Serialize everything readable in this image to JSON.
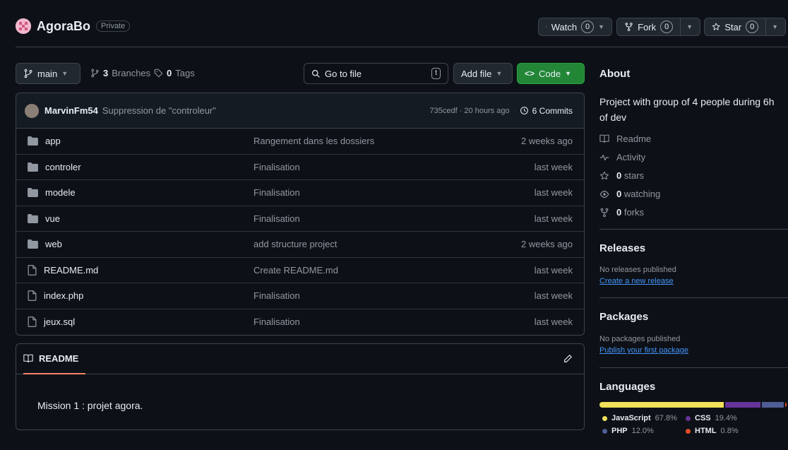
{
  "repo": {
    "name": "AgoraBo",
    "visibility": "Private"
  },
  "actions": {
    "watch_label": "Watch",
    "watch_count": "0",
    "fork_label": "Fork",
    "fork_count": "0",
    "star_label": "Star",
    "star_count": "0"
  },
  "toolbar": {
    "branch": "main",
    "branches_count": "3",
    "branches_label": "Branches",
    "tags_count": "0",
    "tags_label": "Tags",
    "go_to_file_placeholder": "Go to file",
    "go_to_file_key": "t",
    "add_file_label": "Add file",
    "code_label": "Code"
  },
  "commit": {
    "author": "MarvinFm54",
    "message": "Suppression de \"controleur\"",
    "meta": "735cedf · 20 hours ago",
    "commits_label": "6 Commits"
  },
  "files": [
    {
      "type": "folder",
      "name": "app",
      "message": "Rangement dans les dossiers",
      "date": "2 weeks ago"
    },
    {
      "type": "folder",
      "name": "controler",
      "message": "Finalisation",
      "date": "last week"
    },
    {
      "type": "folder",
      "name": "modele",
      "message": "Finalisation",
      "date": "last week"
    },
    {
      "type": "folder",
      "name": "vue",
      "message": "Finalisation",
      "date": "last week"
    },
    {
      "type": "folder",
      "name": "web",
      "message": "add structure project",
      "date": "2 weeks ago"
    },
    {
      "type": "file",
      "name": "README.md",
      "message": "Create README.md",
      "date": "last week"
    },
    {
      "type": "file",
      "name": "index.php",
      "message": "Finalisation",
      "date": "last week"
    },
    {
      "type": "file",
      "name": "jeux.sql",
      "message": "Finalisation",
      "date": "last week"
    }
  ],
  "readme": {
    "tab_label": "README",
    "content": "Mission 1 : projet agora."
  },
  "about": {
    "title": "About",
    "description_line1": "Project with group of 4 people during 6h",
    "description_line2": "of dev",
    "readme_label": "Readme",
    "activity_label": "Activity",
    "stars_count": "0",
    "stars_label": "stars",
    "watching_count": "0",
    "watching_label": "watching",
    "forks_count": "0",
    "forks_label": "forks"
  },
  "releases": {
    "title": "Releases",
    "empty": "No releases published",
    "link": "Create a new release"
  },
  "packages": {
    "title": "Packages",
    "empty": "No packages published",
    "link": "Publish your first package"
  },
  "languages": {
    "title": "Languages",
    "items": [
      {
        "name": "JavaScript",
        "percent": "67.8%",
        "value": 67.8,
        "color": "#f1e05a"
      },
      {
        "name": "CSS",
        "percent": "19.4%",
        "value": 19.4,
        "color": "#663399"
      },
      {
        "name": "PHP",
        "percent": "12.0%",
        "value": 12.0,
        "color": "#4f5d95"
      },
      {
        "name": "HTML",
        "percent": "0.8%",
        "value": 0.8,
        "color": "#e34c26"
      }
    ]
  },
  "colors": {
    "background": "#0d1117",
    "code_button": "#238636",
    "link": "#4493f8",
    "border": "#3d444d"
  }
}
